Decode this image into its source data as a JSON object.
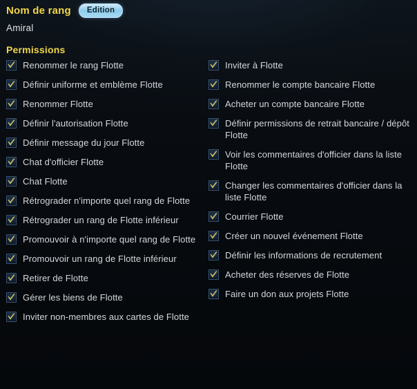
{
  "header": {
    "rank_name_label": "Nom de rang",
    "edition_badge": "Edition",
    "rank_value": "Amiral"
  },
  "permissions_section": {
    "title": "Permissions",
    "left_column": [
      {
        "label": "Renommer le rang Flotte",
        "checked": true
      },
      {
        "label": "Définir uniforme et emblème Flotte",
        "checked": true
      },
      {
        "label": "Renommer Flotte",
        "checked": true
      },
      {
        "label": "Définir l'autorisation Flotte",
        "checked": true
      },
      {
        "label": "Définir message du jour Flotte",
        "checked": true
      },
      {
        "label": "Chat d'officier Flotte",
        "checked": true
      },
      {
        "label": "Chat Flotte",
        "checked": true
      },
      {
        "label": "Rétrograder n'importe quel rang de Flotte",
        "checked": true
      },
      {
        "label": "Rétrograder un rang de Flotte inférieur",
        "checked": true
      },
      {
        "label": "Promouvoir à n'importe quel rang de Flotte",
        "checked": true
      },
      {
        "label": "Promouvoir un rang de Flotte inférieur",
        "checked": true
      },
      {
        "label": "Retirer de Flotte",
        "checked": true
      },
      {
        "label": "Gérer les biens de Flotte",
        "checked": true
      },
      {
        "label": "Inviter non-membres aux cartes de Flotte",
        "checked": true
      }
    ],
    "right_column": [
      {
        "label": "Inviter à Flotte",
        "checked": true
      },
      {
        "label": "Renommer le compte bancaire Flotte",
        "checked": true
      },
      {
        "label": "Acheter un compte bancaire Flotte",
        "checked": true
      },
      {
        "label": "Définir permissions de retrait bancaire / dépôt Flotte",
        "checked": true
      },
      {
        "label": "Voir les commentaires d'officier dans la liste Flotte",
        "checked": true
      },
      {
        "label": "Changer les commentaires d'officier dans la liste Flotte",
        "checked": true
      },
      {
        "label": "Courrier Flotte",
        "checked": true
      },
      {
        "label": "Créer un nouvel événement Flotte",
        "checked": true
      },
      {
        "label": "Définir les informations de recrutement",
        "checked": true
      },
      {
        "label": "Acheter des réserves de Flotte",
        "checked": true
      },
      {
        "label": "Faire un don aux projets Flotte",
        "checked": true
      }
    ]
  },
  "colors": {
    "heading_yellow": "#f0d64a",
    "label_text": "#d4d8dc",
    "checkbox_fill": "#16263a",
    "checkbox_border": "#3a5470",
    "check_mark": "#c9bb63",
    "badge_blue": "#8fcdee",
    "background": "#05080b"
  },
  "icons": {
    "checkmark": "check-icon"
  }
}
